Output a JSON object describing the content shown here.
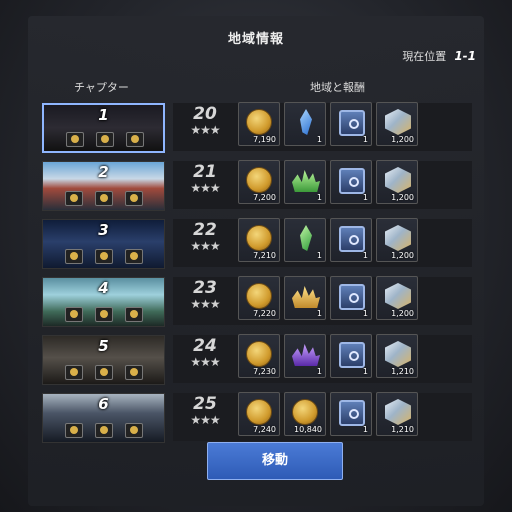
{
  "header": {
    "title": "地域情報",
    "location_label": "現在位置",
    "location_value": "1-1",
    "chapter_header": "チャプター",
    "area_reward_header": "地域と報酬"
  },
  "colors": {
    "accent": "#3f6fd0",
    "selected_border": "#8fb6ff"
  },
  "chapters": [
    {
      "label": "1",
      "selected": true
    },
    {
      "label": "2",
      "selected": false
    },
    {
      "label": "3",
      "selected": false
    },
    {
      "label": "4",
      "selected": false
    },
    {
      "label": "5",
      "selected": false
    },
    {
      "label": "6",
      "selected": false
    }
  ],
  "areas": [
    {
      "level": "20",
      "stars": "★★★",
      "rewards": [
        {
          "icon": "gold-coin-icon",
          "count": "7,190"
        },
        {
          "icon": "blue-crystal-icon",
          "count": "1"
        },
        {
          "icon": "treasure-chest-icon",
          "count": "1"
        },
        {
          "icon": "material-cube-icon",
          "count": "1,200"
        }
      ]
    },
    {
      "level": "21",
      "stars": "★★★",
      "rewards": [
        {
          "icon": "gold-coin-icon",
          "count": "7,200"
        },
        {
          "icon": "green-crystal-cluster-icon",
          "count": "1"
        },
        {
          "icon": "treasure-chest-icon",
          "count": "1"
        },
        {
          "icon": "material-cube-icon",
          "count": "1,200"
        }
      ]
    },
    {
      "level": "22",
      "stars": "★★★",
      "rewards": [
        {
          "icon": "gold-coin-icon",
          "count": "7,210"
        },
        {
          "icon": "green-crystal-icon",
          "count": "1"
        },
        {
          "icon": "treasure-chest-icon",
          "count": "1"
        },
        {
          "icon": "material-cube-icon",
          "count": "1,200"
        }
      ]
    },
    {
      "level": "23",
      "stars": "★★★",
      "rewards": [
        {
          "icon": "gold-coin-icon",
          "count": "7,220"
        },
        {
          "icon": "gold-crystal-cluster-icon",
          "count": "1"
        },
        {
          "icon": "treasure-chest-icon",
          "count": "1"
        },
        {
          "icon": "material-cube-icon",
          "count": "1,200"
        }
      ]
    },
    {
      "level": "24",
      "stars": "★★★",
      "rewards": [
        {
          "icon": "gold-coin-icon",
          "count": "7,230"
        },
        {
          "icon": "purple-crystal-cluster-icon",
          "count": "1"
        },
        {
          "icon": "treasure-chest-icon",
          "count": "1"
        },
        {
          "icon": "material-cube-icon",
          "count": "1,210"
        }
      ]
    },
    {
      "level": "25",
      "stars": "★★★",
      "rewards": [
        {
          "icon": "gold-coin-icon",
          "count": "7,240"
        },
        {
          "icon": "gold-coin-icon",
          "count": "10,840"
        },
        {
          "icon": "treasure-chest-icon",
          "count": "1"
        },
        {
          "icon": "material-cube-icon",
          "count": "1,210"
        }
      ]
    }
  ],
  "move_button": {
    "label": "移動"
  }
}
